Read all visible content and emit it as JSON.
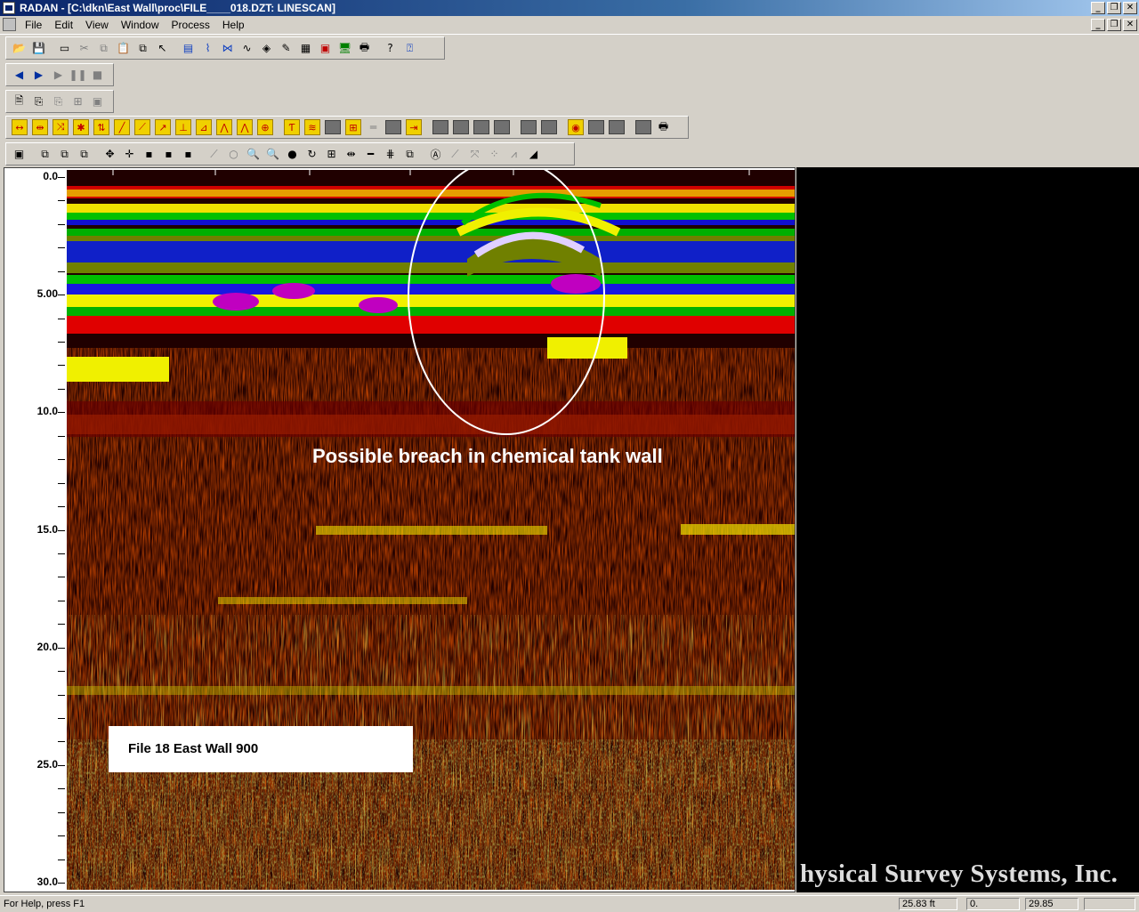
{
  "window": {
    "title": "RADAN - [C:\\dkn\\East Wall\\proc\\FILE____018.DZT:  LINESCAN]",
    "controls": [
      "_",
      "❐",
      "✕"
    ]
  },
  "menu": {
    "items": [
      "File",
      "Edit",
      "View",
      "Window",
      "Process",
      "Help"
    ]
  },
  "toolbars": {
    "standard": [
      "open-icon",
      "save-icon",
      "new-icon",
      "cut-icon",
      "copy-icon",
      "paste-icon",
      "print-preview-icon",
      "pointer-icon",
      "linescan-icon",
      "wiggle-icon",
      "waveform-icon",
      "trace-icon",
      "3d-icon",
      "pen-icon",
      "grid-icon",
      "colormap-icon",
      "monitor-icon",
      "printer-icon",
      "help-icon",
      "context-help-icon"
    ],
    "playback": [
      "back-arrow-icon",
      "forward-arrow-icon",
      "play-icon",
      "pause-icon",
      "stop-icon"
    ],
    "file_ops": [
      "document-icon",
      "export-icon",
      "import-icon",
      "merge-icon",
      "save-all-icon"
    ],
    "process": 29,
    "view": 28
  },
  "ruler": {
    "labels": [
      "0.0",
      "5.00",
      "10.0",
      "15.0",
      "20.0",
      "25.0",
      "30.0"
    ],
    "max": 30
  },
  "annotations": {
    "breach_text": "Possible breach in chemical tank wall",
    "file_label": "File 18 East Wall 900",
    "company": "hysical Survey Systems, Inc."
  },
  "status": {
    "help": "For Help, press F1",
    "distance": "25.83 ft",
    "value1": "0.",
    "value2": "29.85"
  }
}
